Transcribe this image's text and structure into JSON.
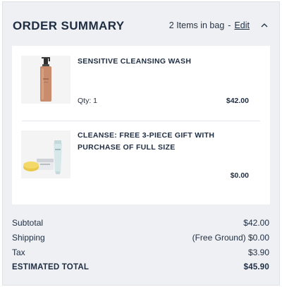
{
  "header": {
    "title": "ORDER SUMMARY",
    "bag_count": "2 Items in bag",
    "separator": "-",
    "edit_label": "Edit"
  },
  "items": [
    {
      "name": "SENSITIVE CLEANSING WASH",
      "qty": "Qty: 1",
      "price": "$42.00",
      "image": "cleansing-wash-bottle"
    },
    {
      "name": "CLEANSE: FREE 3-PIECE GIFT WITH PURCHASE OF FULL SIZE",
      "price": "$0.00",
      "image": "gift-set-products"
    }
  ],
  "totals": {
    "subtotal_label": "Subtotal",
    "subtotal_value": "$42.00",
    "shipping_label": "Shipping",
    "shipping_value": "(Free Ground) $0.00",
    "tax_label": "Tax",
    "tax_value": "$3.90",
    "total_label": "ESTIMATED TOTAL",
    "total_value": "$45.90"
  },
  "colors": {
    "panel_bg": "#eef0f3",
    "card_bg": "#ffffff",
    "text": "#1f2d42"
  }
}
